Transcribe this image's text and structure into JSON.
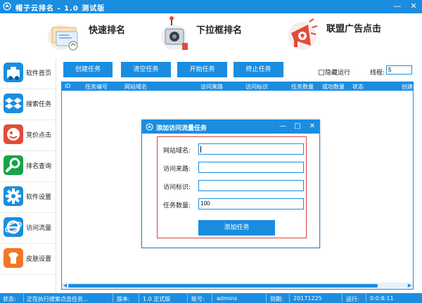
{
  "window": {
    "title": "帽子云排名 - 1.0 测试版",
    "minimize": "—",
    "close": "✕"
  },
  "banner": {
    "items": [
      {
        "label": "快速排名",
        "icon": "fast-ranking-illustration"
      },
      {
        "label": "下拉框排名",
        "icon": "dropdown-ranking-illustration"
      },
      {
        "label": "联盟广告点击",
        "icon": "ad-click-illustration"
      }
    ]
  },
  "sidebar": {
    "items": [
      {
        "label": "软件首页",
        "icon": "home-icon",
        "color": "#1a8ee0"
      },
      {
        "label": "搜索任务",
        "icon": "dropbox-icon",
        "color": "#1a8ee0"
      },
      {
        "label": "竞价点击",
        "icon": "bid-click-icon",
        "color": "#e24b3a"
      },
      {
        "label": "排名查询",
        "icon": "search-icon",
        "color": "#17a34a"
      },
      {
        "label": "软件设置",
        "icon": "gear-icon",
        "color": "#1a8ee0"
      },
      {
        "label": "访问流量",
        "icon": "ie-icon",
        "color": "#1a8ee0"
      },
      {
        "label": "皮肤设置",
        "icon": "skin-icon",
        "color": "#f27628"
      }
    ]
  },
  "toolbar": {
    "create_task": "创建任务",
    "clear_tasks": "清空任务",
    "start_task": "开始任务",
    "stop_task": "终止任务",
    "hide_run": "隐藏运行",
    "hide_run_checked": false,
    "threads_label": "线程:",
    "threads_value": "5"
  },
  "table": {
    "columns": [
      "ID",
      "任务编号",
      "网站域名",
      "访问来路",
      "访问标识",
      "任务数量",
      "成功数量",
      "状态",
      "创建"
    ],
    "rows": []
  },
  "status_bar": {
    "status_label": "状态:",
    "status_value": "正在执行搜索点击任务...",
    "version_label": "版本:",
    "version_value": "1.0 正式版",
    "account_label": "账号:",
    "account_value": "admins",
    "expire_label": "到期:",
    "expire_value": "20171225",
    "runtime_label": "运行:",
    "runtime_value": "0:0:8:11"
  },
  "dialog": {
    "title": "添加访问流量任务",
    "minimize": "—",
    "maximize": "□",
    "close": "✕",
    "fields": [
      {
        "label": "网站域名:",
        "value": ""
      },
      {
        "label": "访问来路:",
        "value": ""
      },
      {
        "label": "访问标识:",
        "value": ""
      },
      {
        "label": "任务数量:",
        "value": "100"
      }
    ],
    "submit": "添加任务"
  },
  "colors": {
    "accent": "#1b8de0",
    "dialog_border_highlight": "#e04040"
  }
}
